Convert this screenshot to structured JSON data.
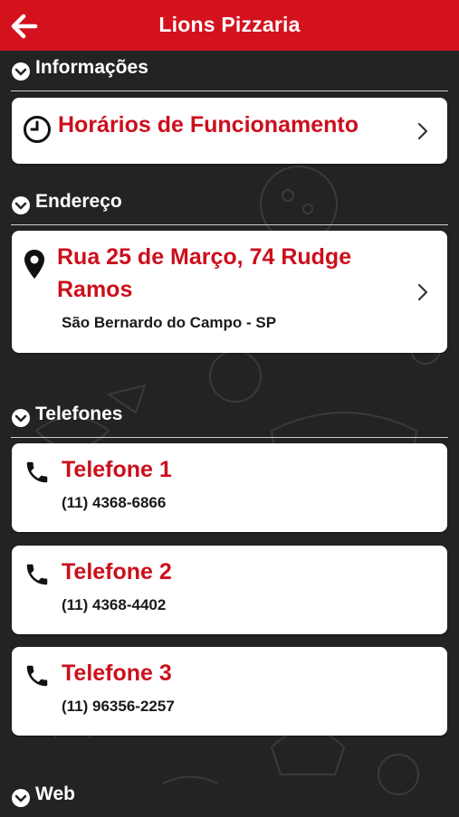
{
  "header": {
    "title": "Lions Pizzaria",
    "back_icon": "arrow-left-icon"
  },
  "colors": {
    "brand_red": "#d3121d",
    "accent_text": "#cc0f1c",
    "background": "#232323"
  },
  "sections": {
    "info": {
      "title": "Informações",
      "hours": {
        "label": "Horários de Funcionamento",
        "icon": "clock-icon"
      }
    },
    "address": {
      "title": "Endereço",
      "street": "Rua 25 de Março, 74 Rudge",
      "street_line2": "Ramos",
      "city": "São Bernardo do Campo - SP",
      "icon": "map-pin-icon"
    },
    "phones": {
      "title": "Telefones",
      "items": [
        {
          "label": "Telefone 1",
          "number": "(11) 4368-6866"
        },
        {
          "label": "Telefone 2",
          "number": "(11) 4368-4402"
        },
        {
          "label": "Telefone 3",
          "number": "(11) 96356-2257"
        }
      ]
    },
    "web": {
      "title": "Web"
    }
  }
}
